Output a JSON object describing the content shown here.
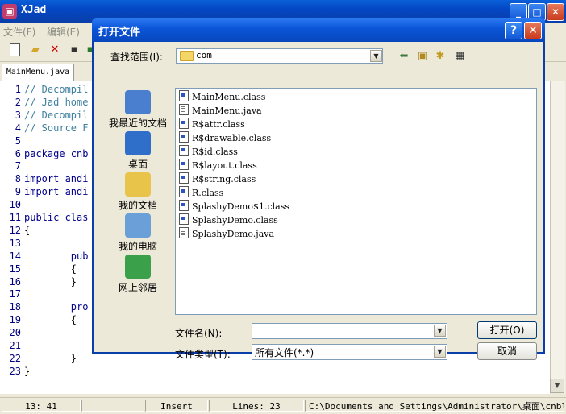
{
  "main_window": {
    "title": "XJad",
    "icon_letter": "▣",
    "caption_buttons": {
      "minimize": "_",
      "maximize": "□",
      "close": "✕"
    }
  },
  "menu": [
    "文件(F)",
    "编辑(E)"
  ],
  "toolbar_icons": [
    "new-file-icon",
    "open-folder-icon",
    "delete-icon",
    "save-icon",
    "export-icon"
  ],
  "tab": {
    "label": "MainMenu.java"
  },
  "editor": {
    "lines": [
      {
        "n": "1",
        "text": "// Decompil",
        "kind": "cm"
      },
      {
        "n": "2",
        "text": "// Jad home",
        "kind": "cm"
      },
      {
        "n": "3",
        "text": "// Decompil",
        "kind": "cm"
      },
      {
        "n": "4",
        "text": "// Source F",
        "kind": "cm"
      },
      {
        "n": "5",
        "text": "",
        "kind": "tx"
      },
      {
        "n": "6",
        "text": "package cnb",
        "kind": "kw"
      },
      {
        "n": "7",
        "text": "",
        "kind": "tx"
      },
      {
        "n": "8",
        "text": "import andi",
        "kind": "kw"
      },
      {
        "n": "9",
        "text": "import andi",
        "kind": "kw"
      },
      {
        "n": "10",
        "text": "",
        "kind": "tx"
      },
      {
        "n": "11",
        "text": "public clas",
        "kind": "kw"
      },
      {
        "n": "12",
        "text": "{",
        "kind": "tx"
      },
      {
        "n": "13",
        "text": "",
        "kind": "tx"
      },
      {
        "n": "14",
        "text": "        pub",
        "kind": "kw"
      },
      {
        "n": "15",
        "text": "        {",
        "kind": "tx"
      },
      {
        "n": "16",
        "text": "        }",
        "kind": "tx"
      },
      {
        "n": "17",
        "text": "",
        "kind": "tx"
      },
      {
        "n": "18",
        "text": "        pro",
        "kind": "kw"
      },
      {
        "n": "19",
        "text": "        {",
        "kind": "tx"
      },
      {
        "n": "20",
        "text": "",
        "kind": "tx"
      },
      {
        "n": "21",
        "text": "",
        "kind": "tx"
      },
      {
        "n": "22",
        "text": "        }",
        "kind": "tx"
      },
      {
        "n": "23",
        "text": "}",
        "kind": "tx"
      }
    ]
  },
  "status": {
    "position": "13: 41",
    "empty": "",
    "mode": "Insert",
    "lines": "Lines: 23",
    "path": "C:\\Documents and Settings\\Administrator\\桌面\\cnblog"
  },
  "dialog": {
    "title": "打开文件",
    "help_label": "?",
    "close_label": "✕",
    "look_in_label": "查找范围(I):",
    "look_in_value": "com",
    "places": [
      {
        "name": "recent-documents",
        "label": "我最近的文档",
        "color": "#4a7fd0"
      },
      {
        "name": "desktop",
        "label": "桌面",
        "color": "#2f6fc9"
      },
      {
        "name": "my-documents",
        "label": "我的文档",
        "color": "#e9c44a"
      },
      {
        "name": "my-computer",
        "label": "我的电脑",
        "color": "#6a9fd8"
      },
      {
        "name": "network-places",
        "label": "网上邻居",
        "color": "#3aa04a"
      }
    ],
    "files": [
      {
        "name": "MainMenu.class",
        "type": "cls"
      },
      {
        "name": "MainMenu.java",
        "type": "jv"
      },
      {
        "name": "R$attr.class",
        "type": "cls"
      },
      {
        "name": "R$drawable.class",
        "type": "cls"
      },
      {
        "name": "R$id.class",
        "type": "cls"
      },
      {
        "name": "R$layout.class",
        "type": "cls"
      },
      {
        "name": "R$string.class",
        "type": "cls"
      },
      {
        "name": "R.class",
        "type": "cls"
      },
      {
        "name": "SplashyDemo$1.class",
        "type": "cls"
      },
      {
        "name": "SplashyDemo.class",
        "type": "cls"
      },
      {
        "name": "SplashyDemo.java",
        "type": "jv"
      }
    ],
    "filename_label": "文件名(N):",
    "filename_value": "",
    "filetype_label": "文件类型(T):",
    "filetype_value": "所有文件(*.*)",
    "open_button": "打开(O)",
    "cancel_button": "取消"
  }
}
